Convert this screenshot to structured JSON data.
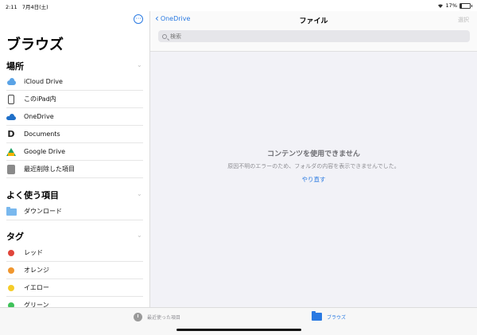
{
  "status": {
    "time": "2:11",
    "date": "7月4日(土)",
    "battery": "17%",
    "battery_level": 0.17
  },
  "sidebar": {
    "title": "ブラウズ",
    "locations": {
      "heading": "場所",
      "items": [
        {
          "label": "iCloud Drive",
          "icon": "icloud-icon"
        },
        {
          "label": "このiPad内",
          "icon": "ipad-icon"
        },
        {
          "label": "OneDrive",
          "icon": "onedrive-icon"
        },
        {
          "label": "Documents",
          "icon": "documents-icon",
          "glyph": "D"
        },
        {
          "label": "Google Drive",
          "icon": "google-drive-icon"
        },
        {
          "label": "最近削除した項目",
          "icon": "trash-icon"
        }
      ]
    },
    "favorites": {
      "heading": "よく使う項目",
      "items": [
        {
          "label": "ダウンロード",
          "icon": "folder-icon"
        }
      ]
    },
    "tags": {
      "heading": "タグ",
      "items": [
        {
          "label": "レッド",
          "color": "#e0453a"
        },
        {
          "label": "オレンジ",
          "color": "#f0962e"
        },
        {
          "label": "イエロー",
          "color": "#f5cc29"
        },
        {
          "label": "グリーン",
          "color": "#3fc25a"
        }
      ]
    }
  },
  "main": {
    "back_label": "OneDrive",
    "title": "ファイル",
    "select_label": "選択",
    "search_placeholder": "検索",
    "empty_title": "コンテンツを使用できません",
    "empty_message": "原因不明のエラーのため、フォルダの内容を表示できませんでした。",
    "retry_label": "やり直す"
  },
  "tabbar": {
    "recent_label": "最近使った項目",
    "browse_label": "ブラウズ"
  },
  "colors": {
    "accent": "#2a7ae2"
  }
}
